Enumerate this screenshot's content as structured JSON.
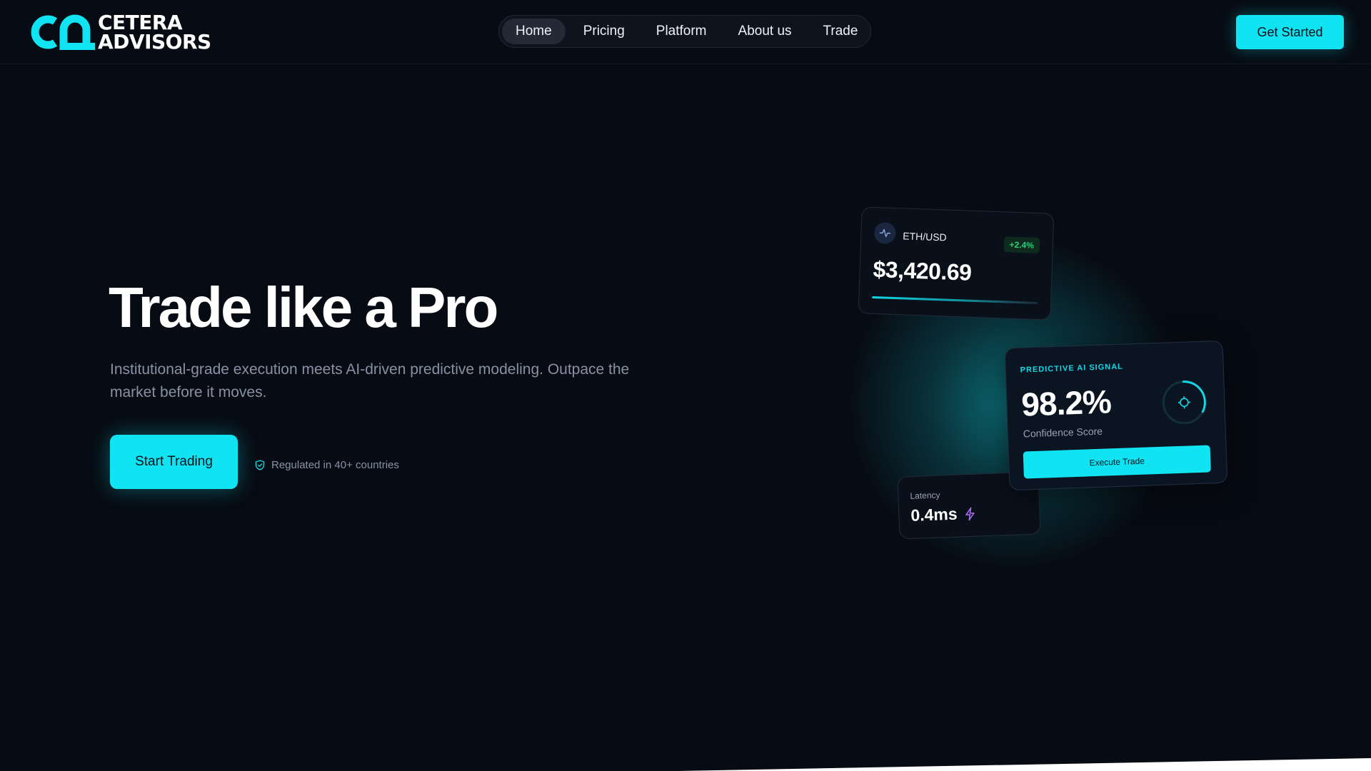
{
  "brand": {
    "name_line1": "Cetera",
    "name_line2": "Advisors",
    "accent_color": "#10e4f2",
    "background_color": "#070b13"
  },
  "nav": {
    "items": [
      {
        "label": "Home",
        "active": true
      },
      {
        "label": "Pricing",
        "active": false
      },
      {
        "label": "Platform",
        "active": false
      },
      {
        "label": "About us",
        "active": false
      },
      {
        "label": "Trade",
        "active": false
      }
    ]
  },
  "header": {
    "cta_label": "Get Started"
  },
  "hero": {
    "title": "Trade like a Pro",
    "subtitle": "Institutional-grade execution meets AI-driven predictive modeling. Outpace the market before it moves.",
    "cta_label": "Start Trading",
    "regulated_text": "Regulated in 40+ countries",
    "regulated_icon": "shield-check-icon"
  },
  "cards": {
    "eth": {
      "icon": "activity-icon",
      "pair": "ETH/USD",
      "change": "+2.4%",
      "price": "$3,420.69",
      "change_color": "#27d27a"
    },
    "ai_signal": {
      "label": "PREDICTIVE AI SIGNAL",
      "value": "98.2%",
      "sublabel": "Confidence Score",
      "button_label": "Execute Trade",
      "icon": "crosshair-icon"
    },
    "latency": {
      "label": "Latency",
      "value": "0.4ms",
      "icon": "lightning-icon",
      "icon_color": "#a970f5"
    }
  }
}
